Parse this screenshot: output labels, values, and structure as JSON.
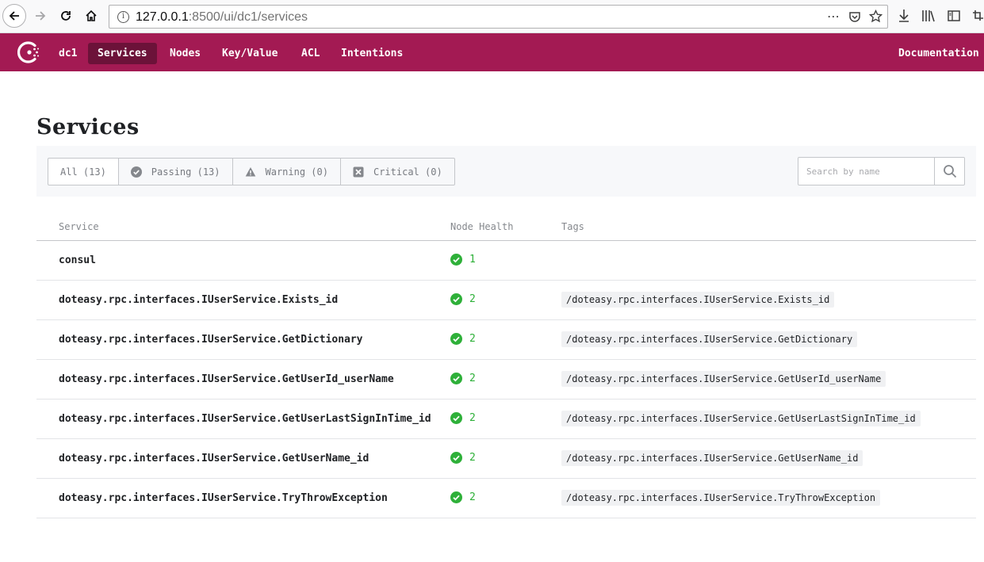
{
  "browser": {
    "url_host": "127.0.0.1",
    "url_rest": ":8500/ui/dc1/services"
  },
  "nav": {
    "datacenter": "dc1",
    "items": [
      "Services",
      "Nodes",
      "Key/Value",
      "ACL",
      "Intentions"
    ],
    "active": "Services",
    "documentation": "Documentation"
  },
  "page": {
    "title": "Services",
    "filters": [
      {
        "label": "All (13)",
        "icon": ""
      },
      {
        "label": "Passing (13)",
        "icon": "check-circle-icon"
      },
      {
        "label": "Warning (0)",
        "icon": "warning-triangle-icon"
      },
      {
        "label": "Critical (0)",
        "icon": "critical-x-icon"
      }
    ],
    "search_placeholder": "Search by name"
  },
  "table": {
    "headers": {
      "service": "Service",
      "health": "Node Health",
      "tags": "Tags"
    },
    "rows": [
      {
        "name": "consul",
        "health": "1",
        "tag": ""
      },
      {
        "name": "doteasy.rpc.interfaces.IUserService.Exists_id",
        "health": "2",
        "tag": "/doteasy.rpc.interfaces.IUserService.Exists_id"
      },
      {
        "name": "doteasy.rpc.interfaces.IUserService.GetDictionary",
        "health": "2",
        "tag": "/doteasy.rpc.interfaces.IUserService.GetDictionary"
      },
      {
        "name": "doteasy.rpc.interfaces.IUserService.GetUserId_userName",
        "health": "2",
        "tag": "/doteasy.rpc.interfaces.IUserService.GetUserId_userName"
      },
      {
        "name": "doteasy.rpc.interfaces.IUserService.GetUserLastSignInTime_id",
        "health": "2",
        "tag": "/doteasy.rpc.interfaces.IUserService.GetUserLastSignInTime_id"
      },
      {
        "name": "doteasy.rpc.interfaces.IUserService.GetUserName_id",
        "health": "2",
        "tag": "/doteasy.rpc.interfaces.IUserService.GetUserName_id"
      },
      {
        "name": "doteasy.rpc.interfaces.IUserService.TryThrowException",
        "health": "2",
        "tag": "/doteasy.rpc.interfaces.IUserService.TryThrowException"
      }
    ]
  },
  "colors": {
    "brand": "#a31a53",
    "brand_dark": "#6c1239",
    "passing": "#2eb039"
  }
}
